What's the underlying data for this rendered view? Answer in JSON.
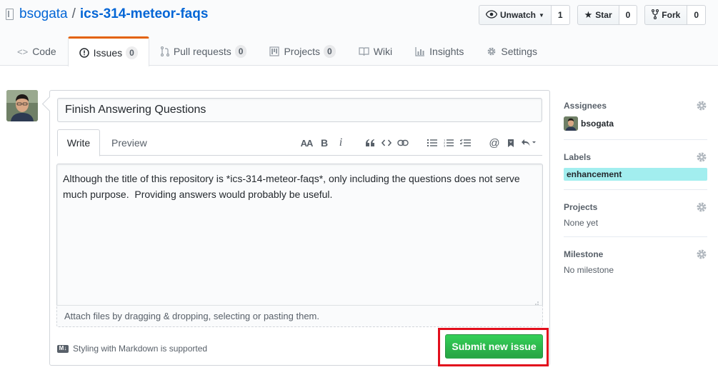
{
  "repo": {
    "owner": "bsogata",
    "separator": "/",
    "name": "ics-314-meteor-faqs"
  },
  "actions": [
    {
      "label": "Unwatch",
      "icon": "eye-icon",
      "count": "1",
      "has_caret": true
    },
    {
      "label": "Star",
      "icon": "star-icon",
      "count": "0"
    },
    {
      "label": "Fork",
      "icon": "fork-icon",
      "count": "0"
    }
  ],
  "tabs": [
    {
      "label": "Code",
      "icon": "code-icon"
    },
    {
      "label": "Issues",
      "icon": "issue-opened-icon",
      "counter": "0",
      "selected": true
    },
    {
      "label": "Pull requests",
      "icon": "git-pull-request-icon",
      "counter": "0"
    },
    {
      "label": "Projects",
      "icon": "project-icon",
      "counter": "0"
    },
    {
      "label": "Wiki",
      "icon": "book-icon"
    },
    {
      "label": "Insights",
      "icon": "graph-icon"
    },
    {
      "label": "Settings",
      "icon": "gear-icon"
    }
  ],
  "form": {
    "title_value": "Finish Answering Questions",
    "write_tab": "Write",
    "preview_tab": "Preview",
    "toolbar": {
      "header": "AA",
      "bold": "B",
      "italic": "i"
    },
    "body_value": "Although the title of this repository is *ics-314-meteor-faqs*, only including the questions does not serve much purpose.  Providing answers would probably be useful.",
    "dropzone_text": "Attach files by dragging & dropping, selecting or pasting them.",
    "markdown_note": "Styling with Markdown is supported",
    "markdown_badge": "M↓",
    "submit_label": "Submit new issue",
    "colors": {
      "submit": "#28a745",
      "highlight": "#e20e1c"
    }
  },
  "sidebar": {
    "assignees": {
      "heading": "Assignees",
      "user": "bsogata"
    },
    "labels": {
      "heading": "Labels",
      "chip": "enhancement",
      "chip_color": "#a2eeef"
    },
    "projects": {
      "heading": "Projects",
      "value": "None yet"
    },
    "milestone": {
      "heading": "Milestone",
      "value": "No milestone"
    }
  }
}
